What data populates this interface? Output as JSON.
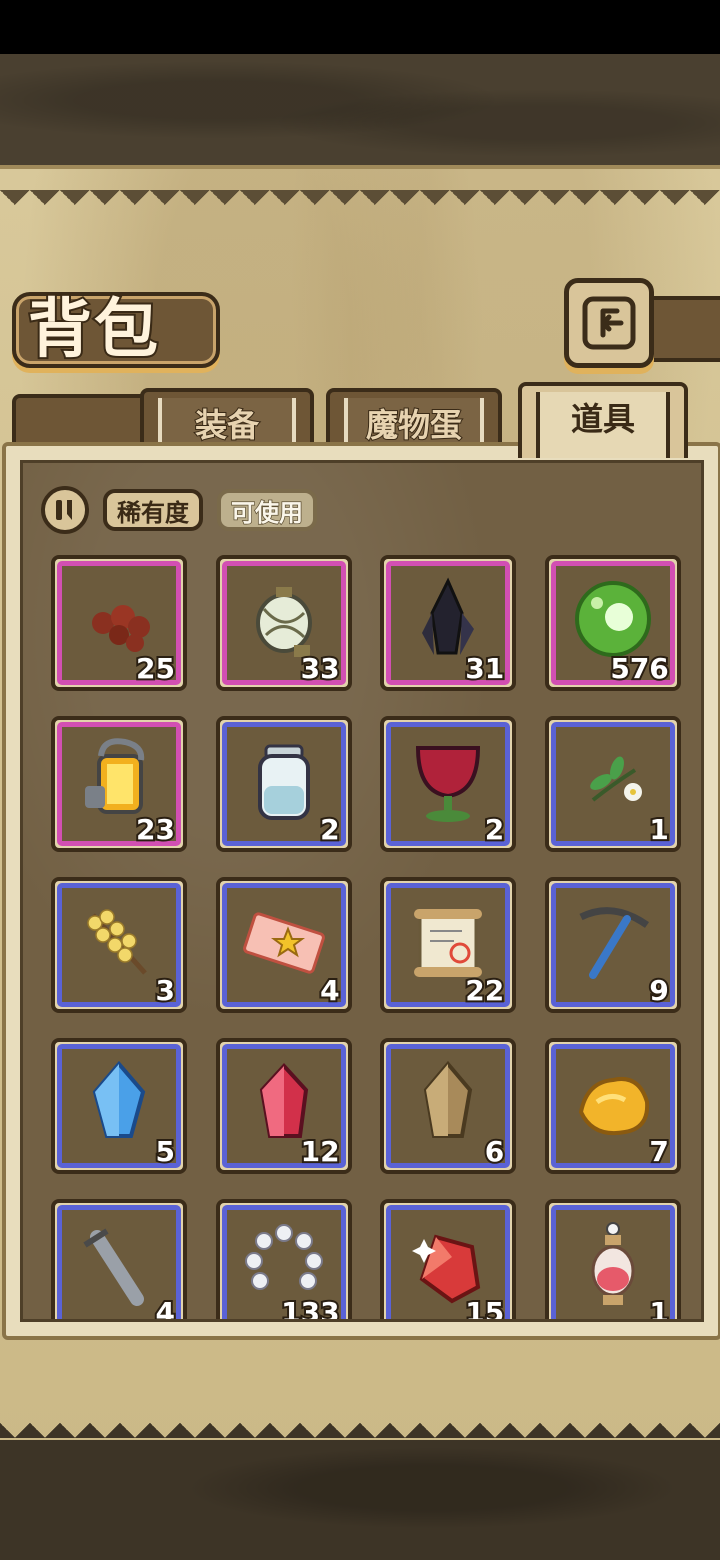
{
  "title": "背包",
  "tabs": [
    {
      "label": "装备",
      "active": false
    },
    {
      "label": "魔物蛋",
      "active": false
    },
    {
      "label": "道具",
      "active": true
    }
  ],
  "filters": {
    "rarity_label": "稀有度",
    "usable_label": "可使用"
  },
  "items": [
    {
      "icon": "seeds-icon",
      "count": "25",
      "rarity": "purple"
    },
    {
      "icon": "lantern-icon",
      "count": "33",
      "rarity": "purple"
    },
    {
      "icon": "dark-crystal-icon",
      "count": "31",
      "rarity": "purple"
    },
    {
      "icon": "green-orb-icon",
      "count": "576",
      "rarity": "purple"
    },
    {
      "icon": "fuel-tank-icon",
      "count": "23",
      "rarity": "purple"
    },
    {
      "icon": "water-jar-icon",
      "count": "2",
      "rarity": "blue"
    },
    {
      "icon": "wine-cup-icon",
      "count": "2",
      "rarity": "blue"
    },
    {
      "icon": "herb-sprig-icon",
      "count": "1",
      "rarity": "blue"
    },
    {
      "icon": "yellow-flower-branch-icon",
      "count": "3",
      "rarity": "blue"
    },
    {
      "icon": "star-ticket-icon",
      "count": "4",
      "rarity": "blue"
    },
    {
      "icon": "scroll-icon",
      "count": "22",
      "rarity": "blue"
    },
    {
      "icon": "pickaxe-icon",
      "count": "9",
      "rarity": "blue"
    },
    {
      "icon": "blue-crystal-icon",
      "count": "5",
      "rarity": "blue"
    },
    {
      "icon": "red-crystal-icon",
      "count": "12",
      "rarity": "blue"
    },
    {
      "icon": "brown-crystal-icon",
      "count": "6",
      "rarity": "blue"
    },
    {
      "icon": "gold-ore-icon",
      "count": "7",
      "rarity": "blue"
    },
    {
      "icon": "broken-sword-icon",
      "count": "4",
      "rarity": "blue"
    },
    {
      "icon": "pearl-necklace-icon",
      "count": "133",
      "rarity": "blue"
    },
    {
      "icon": "red-gem-shard-icon",
      "count": "15",
      "rarity": "blue"
    },
    {
      "icon": "perfume-bottle-icon",
      "count": "1",
      "rarity": "blue"
    }
  ]
}
